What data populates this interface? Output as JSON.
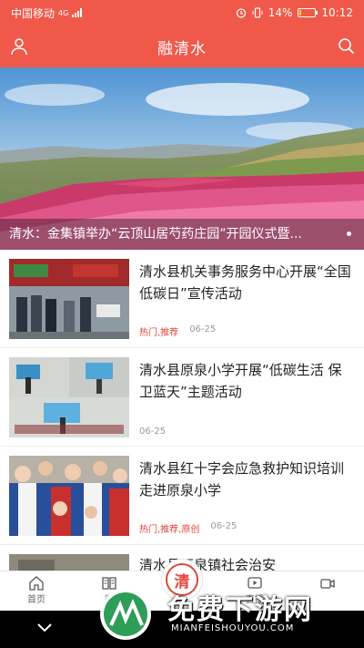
{
  "status_bar": {
    "carrier": "中国移动",
    "network": "4G",
    "battery_percent": "14%",
    "battery_level": 0.14,
    "time": "10:12"
  },
  "header": {
    "title": "融清水",
    "left_icon": "user-icon",
    "right_icon": "search-icon"
  },
  "banner": {
    "caption": "清水：金集镇举办“云顶山居芍药庄园”开园仪式暨..."
  },
  "news": [
    {
      "title": "清水县机关事务服务中心开展“全国低碳日”宣传活动",
      "tags": "热门,推荐",
      "date": "06-25"
    },
    {
      "title": "清水县原泉小学开展“低碳生活 保卫蓝天”主题活动",
      "tags": "",
      "date": "06-25"
    },
    {
      "title": "清水县红十字会应急救护知识培训走进原泉小学",
      "tags": "热门,推荐,原创",
      "date": "06-25"
    },
    {
      "title": "清水县原泉镇社会治安",
      "tags": "",
      "date": ""
    }
  ],
  "tabs": [
    {
      "label": "首页",
      "icon": "home-icon"
    },
    {
      "label": "微",
      "icon": "book-icon"
    },
    {
      "label": "",
      "icon": "qing-center-icon",
      "center_char": "清"
    },
    {
      "label": "直播",
      "icon": "video-play-icon"
    },
    {
      "label": "",
      "icon": "camera-icon"
    }
  ],
  "watermark": {
    "text": "免费下游网",
    "sub": "MIANFEISHOUYOU.COM"
  },
  "colors": {
    "primary": "#f0594a",
    "tag_red": "#e2453a",
    "meta_gray": "#999999"
  }
}
